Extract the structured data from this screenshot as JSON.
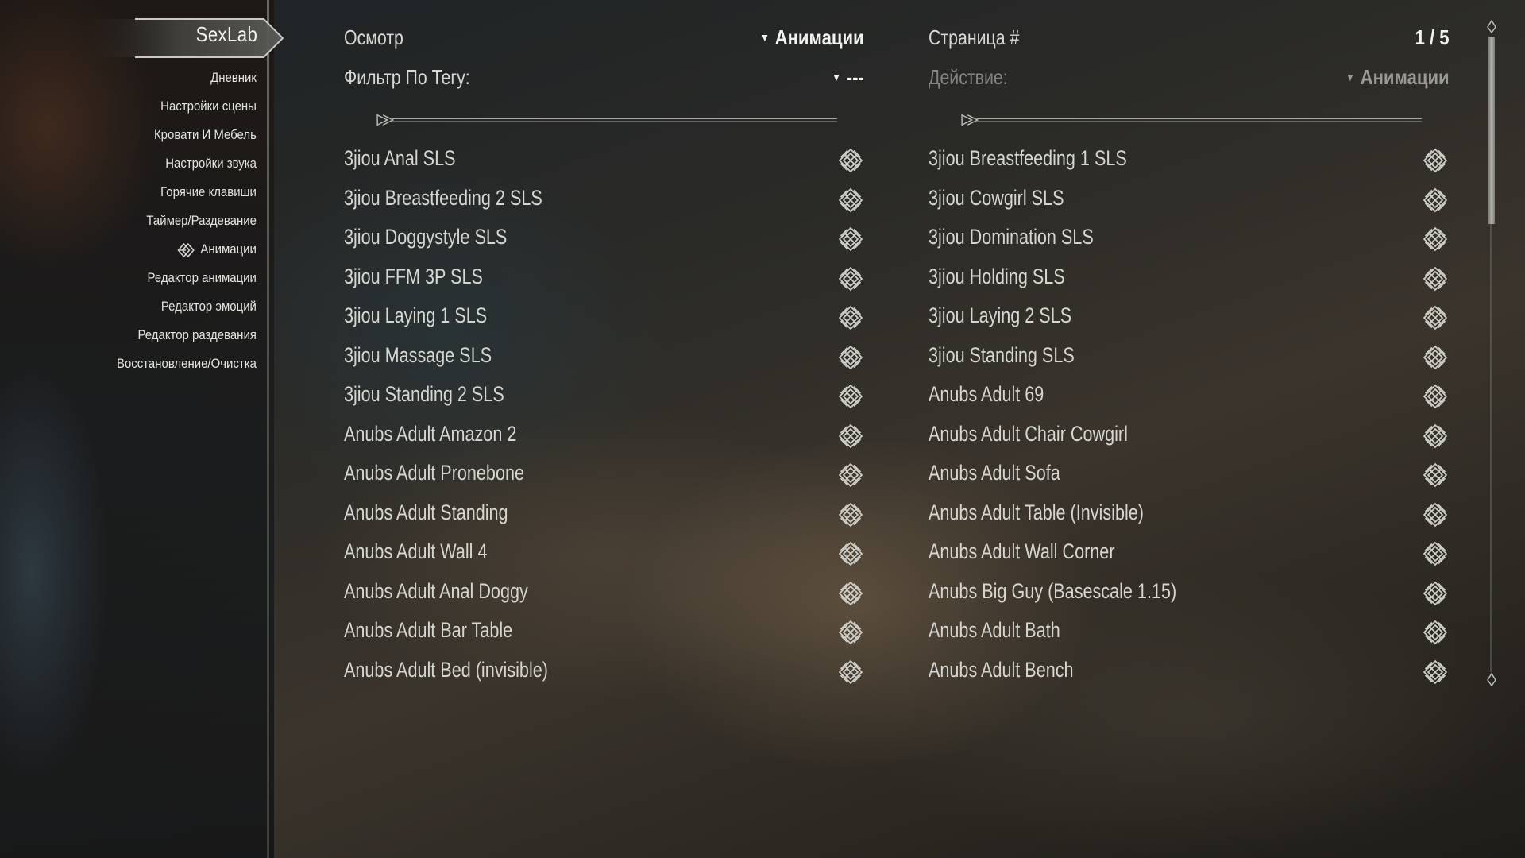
{
  "app": {
    "title": "SexLab"
  },
  "sidebar": {
    "items": [
      {
        "label": "Дневник"
      },
      {
        "label": "Настройки сцены"
      },
      {
        "label": "Кровати И Мебель"
      },
      {
        "label": "Настройки звука"
      },
      {
        "label": "Горячие клавиши"
      },
      {
        "label": "Таймер/Раздевание"
      },
      {
        "label": "Анимации",
        "active": true
      },
      {
        "label": "Редактор анимации"
      },
      {
        "label": "Редактор эмоций"
      },
      {
        "label": "Редактор раздевания"
      },
      {
        "label": "Восстановление/Очистка"
      }
    ]
  },
  "header": {
    "left": {
      "view_label": "Осмотр",
      "view_value": "Анимации",
      "filter_label": "Фильтр По Тегу:",
      "filter_value": "---"
    },
    "right": {
      "page_label": "Страница #",
      "page_value": "1 / 5",
      "action_label": "Действие:",
      "action_value": "Анимации"
    }
  },
  "list_left": [
    {
      "label": "3jiou Anal SLS"
    },
    {
      "label": "3jiou Breastfeeding 2 SLS"
    },
    {
      "label": "3jiou Doggystyle SLS"
    },
    {
      "label": "3jiou FFM 3P SLS"
    },
    {
      "label": "3jiou Laying 1 SLS"
    },
    {
      "label": "3jiou Massage SLS"
    },
    {
      "label": "3jiou Standing 2 SLS"
    },
    {
      "label": "Anubs  Adult Amazon 2"
    },
    {
      "label": "Anubs Adult Pronebone"
    },
    {
      "label": "Anubs Adult Standing"
    },
    {
      "label": "Anubs Adult Wall 4"
    },
    {
      "label": "Anubs Adult Anal Doggy"
    },
    {
      "label": "Anubs Adult Bar Table"
    },
    {
      "label": "Anubs Adult Bed (invisible)"
    }
  ],
  "list_right": [
    {
      "label": "3jiou Breastfeeding 1 SLS"
    },
    {
      "label": "3jiou Cowgirl SLS"
    },
    {
      "label": "3jiou Domination SLS"
    },
    {
      "label": "3jiou Holding SLS"
    },
    {
      "label": "3jiou Laying 2 SLS"
    },
    {
      "label": "3jiou Standing SLS"
    },
    {
      "label": "Anubs Adult 69"
    },
    {
      "label": "Anubs  Adult Chair Cowgirl"
    },
    {
      "label": "Anubs  Adult Sofa"
    },
    {
      "label": "Anubs Adult Table (Invisible)"
    },
    {
      "label": "Anubs Adult Wall Corner"
    },
    {
      "label": "Anubs Big Guy (Basescale 1.15)"
    },
    {
      "label": "Anubs Adult Bath"
    },
    {
      "label": "Anubs  Adult Bench"
    }
  ],
  "icons": {
    "checkbox": "knot-checkbox-icon",
    "active_marker": "sidebar-selection-icon",
    "dropdown": "dropdown-arrow-icon"
  },
  "colors": {
    "text": "#d6d6d1",
    "text_bright": "#f3f3ef",
    "text_dim": "#85857f"
  }
}
